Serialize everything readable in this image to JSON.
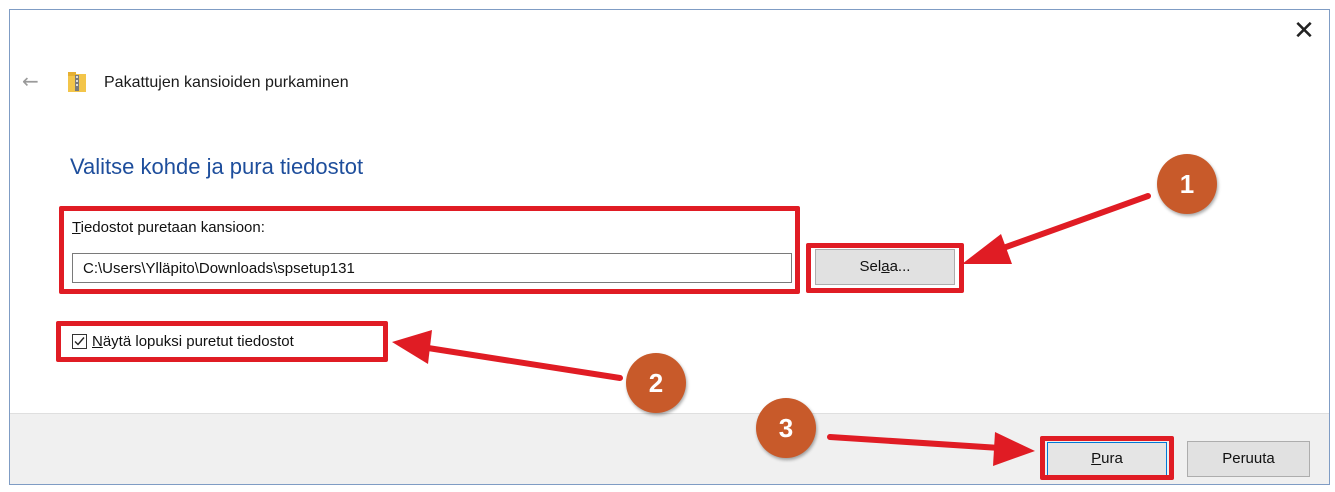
{
  "window": {
    "title": "Pakattujen kansioiden purkaminen",
    "close_glyph": "✕",
    "back_glyph": "←"
  },
  "main": {
    "heading": "Valitse kohde ja pura tiedostot",
    "destination": {
      "label_first": "T",
      "label_rest": "iedostot puretaan kansioon:",
      "value": "C:\\Users\\Ylläpito\\Downloads\\spsetup131"
    },
    "browse_button": {
      "before": "Sel",
      "underlined": "a",
      "after": "a..."
    },
    "show_files_checkbox": {
      "checked": true,
      "label_first": "N",
      "label_rest": "äytä lopuksi puretut tiedostot"
    }
  },
  "footer": {
    "extract_button": {
      "underlined": "P",
      "after": "ura"
    },
    "cancel_button": "Peruuta"
  },
  "annotations": {
    "badges": [
      "1",
      "2",
      "3"
    ],
    "highlight_color": "#e01c24",
    "badge_color": "#c85a2a"
  },
  "icons": {
    "back": "back-arrow-icon",
    "folder": "zip-folder-icon",
    "close": "close-icon",
    "check": "checkmark-icon"
  }
}
